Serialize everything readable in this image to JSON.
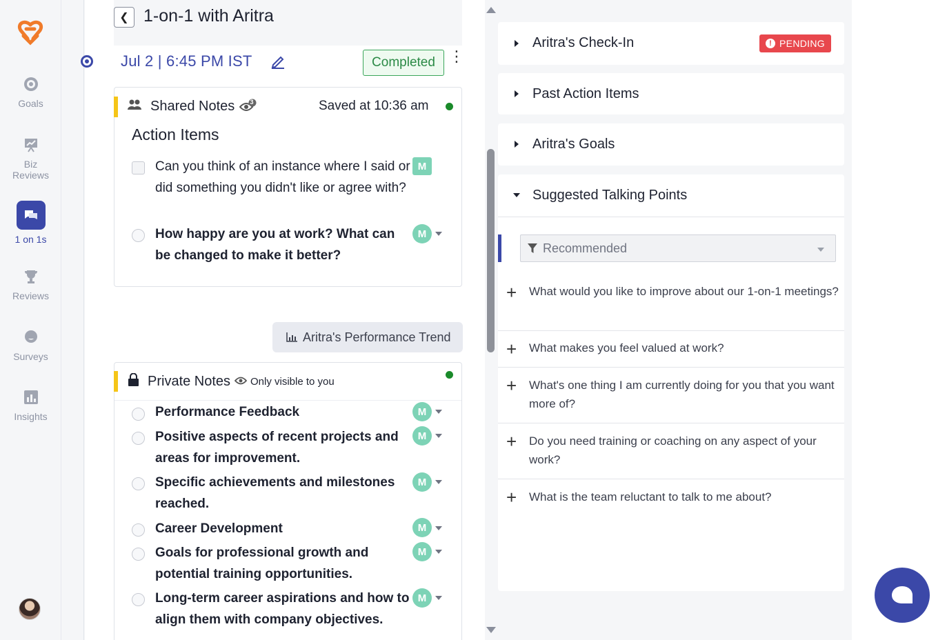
{
  "sidebar": {
    "items": [
      {
        "label": "Goals",
        "icon": "target-icon"
      },
      {
        "label": "Biz Reviews",
        "icon": "presentation-chart-icon"
      },
      {
        "label": "1 on 1s",
        "icon": "chat-bubbles-icon",
        "active": true
      },
      {
        "label": "Reviews",
        "icon": "trophy-icon"
      },
      {
        "label": "Surveys",
        "icon": "survey-bubble-icon"
      },
      {
        "label": "Insights",
        "icon": "bar-chart-icon"
      }
    ]
  },
  "header": {
    "title": "1-on-1 with Aritra",
    "date": "Jul 2  |  6:45 PM  IST",
    "status": "Completed"
  },
  "shared_notes": {
    "title": "Shared Notes",
    "viewer_count": "3",
    "saved_text": "Saved at 10:36 am",
    "section_heading": "Action Items",
    "items": [
      {
        "text": "Can you think of an instance where I said or did something you didn't like or agree with?",
        "assignee": "M"
      },
      {
        "text": "How happy are you at work? What can be changed to make it better?",
        "assignee": "M"
      }
    ]
  },
  "trend_button": "Aritra's Performance Trend",
  "private_notes": {
    "title": "Private Notes",
    "visibility": "Only visible to you",
    "items": [
      {
        "text": "Performance Feedback",
        "assignee": "M"
      },
      {
        "text": "Positive aspects of recent projects and areas for improvement.",
        "assignee": "M"
      },
      {
        "text": "Specific achievements and milestones reached.",
        "assignee": "M"
      },
      {
        "text": "Career Development",
        "assignee": "M"
      },
      {
        "text": "Goals for professional growth and potential training opportunities.",
        "assignee": "M"
      },
      {
        "text": "Long-term career aspirations and how to align them with company objectives.",
        "assignee": "M"
      }
    ]
  },
  "right_panel": {
    "checkin": {
      "title": "Aritra's Check-In",
      "badge": "PENDING"
    },
    "past_actions": {
      "title": "Past Action Items"
    },
    "goals": {
      "title": "Aritra's Goals"
    },
    "talking_points": {
      "title": "Suggested Talking Points",
      "filter": "Recommended",
      "items": [
        "What would you like to improve about our 1-on-1 meetings?",
        "What makes you feel valued at work?",
        "What's one thing I am currently doing for you that you want more of?",
        "Do you need training or coaching on any aspect of your work?",
        "What is the team reluctant to talk to me about?"
      ]
    }
  },
  "colors": {
    "accent": "#3b48a8",
    "logo": "#f07b2a",
    "pending": "#e8474d",
    "completed": "#2b8a46",
    "assignee_badge": "#7dd3b6",
    "notes_bar": "#f5c518"
  }
}
